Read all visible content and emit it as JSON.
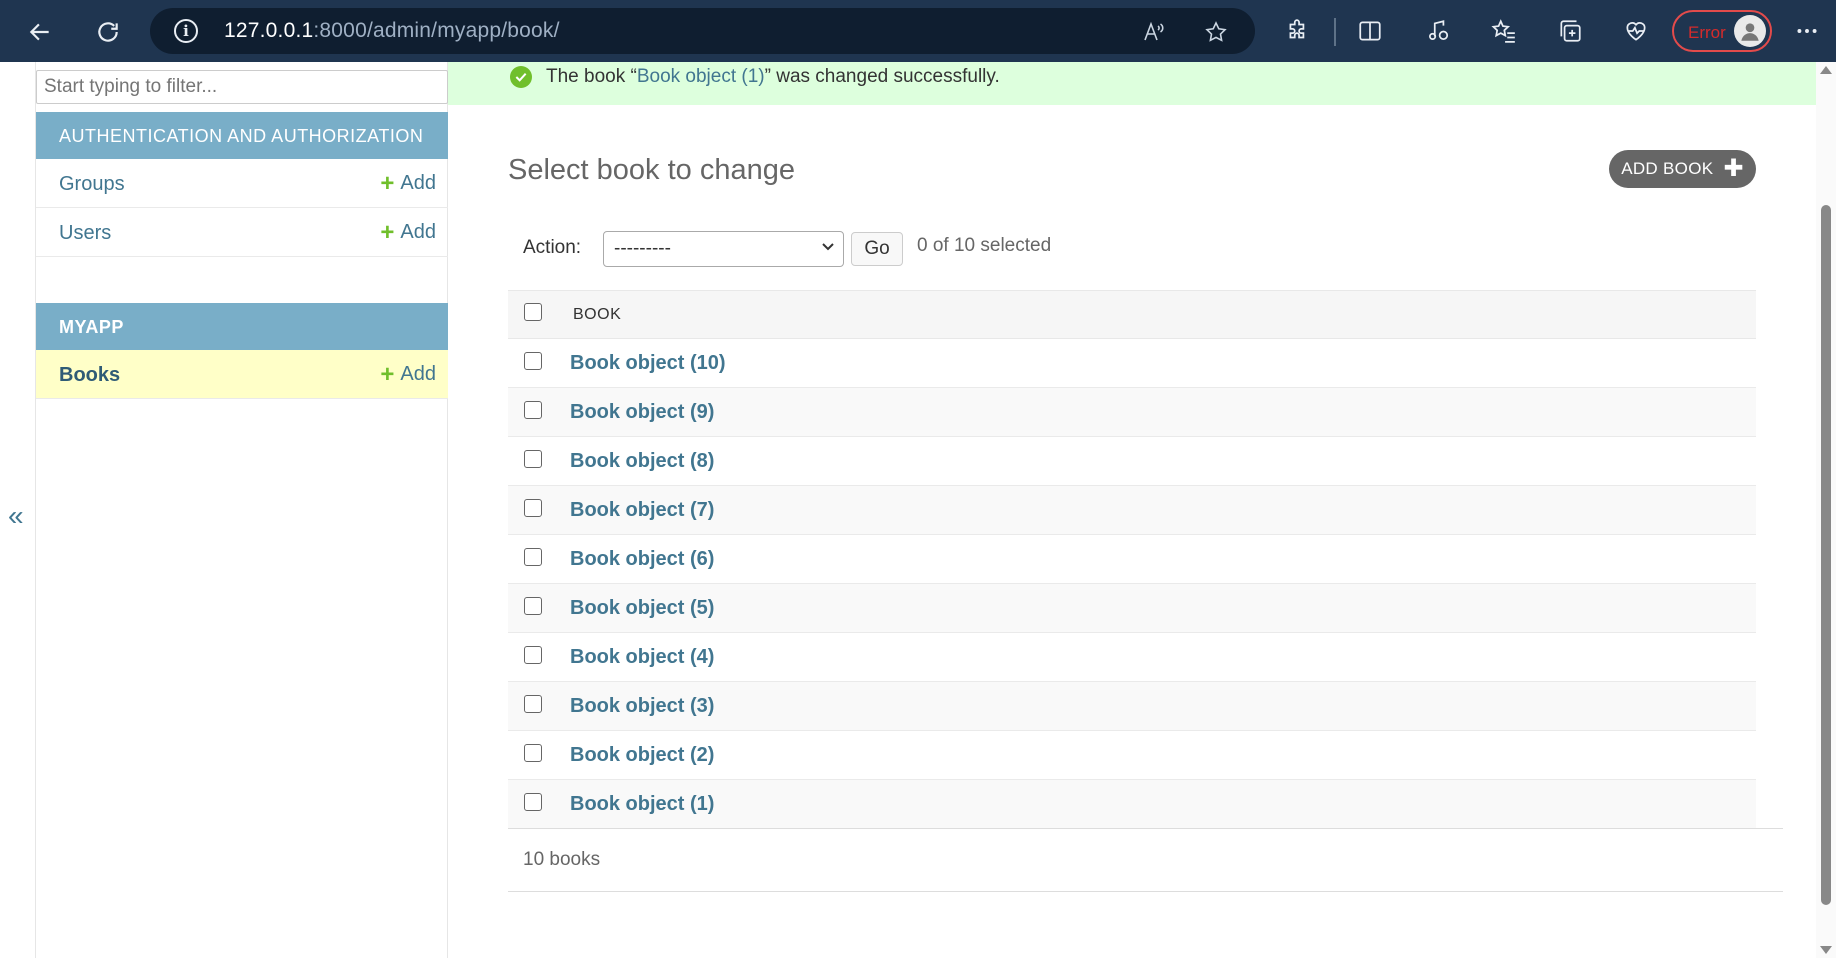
{
  "browser": {
    "url_host": "127.0.0.1",
    "url_rest": ":8000/admin/myapp/book/",
    "profile_status": "Error",
    "icons": [
      "back-arrow-icon",
      "refresh-icon",
      "info-icon",
      "read-aloud-icon",
      "favorite-star-icon",
      "extensions-icon",
      "split-screen-icon",
      "media-icon",
      "favorites-list-icon",
      "collections-icon",
      "performance-icon",
      "profile-icon",
      "more-icon"
    ]
  },
  "sidebar": {
    "filter_placeholder": "Start typing to filter...",
    "apps": [
      {
        "header": "AUTHENTICATION AND AUTHORIZATION",
        "models": [
          {
            "name": "Groups",
            "add": "Add"
          },
          {
            "name": "Users",
            "add": "Add"
          }
        ]
      },
      {
        "header": "MYAPP",
        "models": [
          {
            "name": "Books",
            "add": "Add"
          }
        ]
      }
    ],
    "collapse_glyph": "«"
  },
  "message": {
    "prefix": "The book “",
    "link": "Book object (1)",
    "suffix": "” was changed successfully."
  },
  "main": {
    "title": "Select book to change",
    "add_button": "ADD BOOK",
    "action_label": "Action:",
    "action_selected": "---------",
    "go_label": "Go",
    "selected_count": "0 of 10 selected",
    "column_header": "BOOK",
    "rows": [
      "Book object (10)",
      "Book object (9)",
      "Book object (8)",
      "Book object (7)",
      "Book object (6)",
      "Book object (5)",
      "Book object (4)",
      "Book object (3)",
      "Book object (2)",
      "Book object (1)"
    ],
    "result_count": "10 books"
  },
  "colors": {
    "browser_bar": "#1f3550",
    "module_header": "#79aec8",
    "link": "#417690",
    "add_plus": "#70bf2b",
    "success_bg": "#ddffdd",
    "current_model_bg": "#ffffc8"
  }
}
